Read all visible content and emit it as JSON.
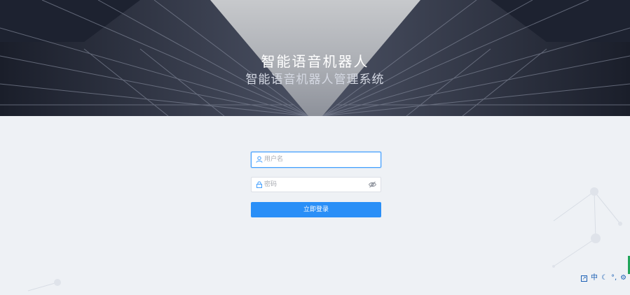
{
  "hero": {
    "title": "智能语音机器人",
    "subtitle": "智能语音机器人管理系统"
  },
  "login_form": {
    "username_placeholder": "用户名",
    "password_placeholder": "密码",
    "submit_label": "立即登录"
  },
  "ime_toolbar": {
    "items": [
      {
        "icon": "expand-icon"
      },
      {
        "label": "中",
        "icon": "chinese-mode-icon"
      },
      {
        "icon": "moon-icon"
      },
      {
        "icon": "punctuation-icon"
      },
      {
        "icon": "gear-icon"
      }
    ]
  },
  "colors": {
    "accent": "#2a8ff7",
    "focus_border": "#409eff",
    "page_background": "#eef1f5"
  }
}
